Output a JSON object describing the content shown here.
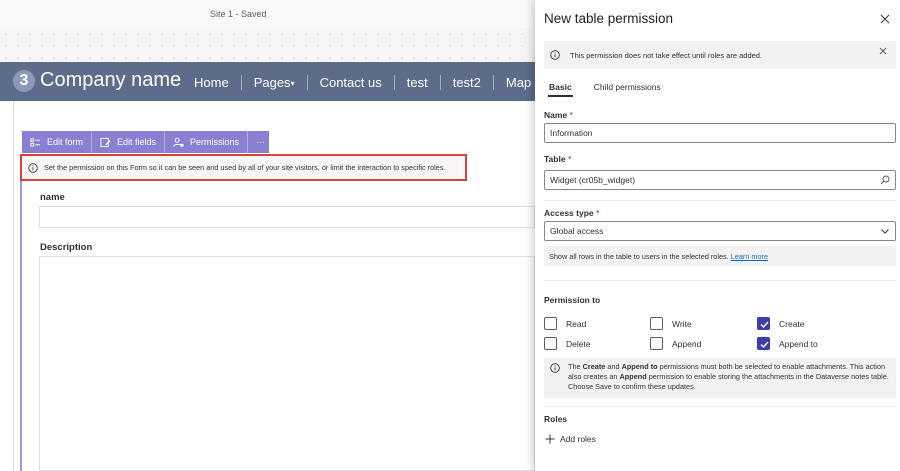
{
  "topbar": {
    "site_status": "Site 1 - Saved"
  },
  "site": {
    "logo_badge": "3",
    "company_name": "Company name",
    "nav": [
      "Home",
      "Pages",
      "Contact us",
      "test",
      "test2",
      "Map"
    ]
  },
  "form_toolbar": {
    "edit_form": "Edit form",
    "edit_fields": "Edit fields",
    "permissions": "Permissions",
    "more": "···"
  },
  "permission_notice": "Set the permission on this Form so it can be seen and used by all of your site visitors, or limit the interaction to specific roles.",
  "form_fields": {
    "name_label": "name",
    "description_label": "Description"
  },
  "panel": {
    "title": "New table permission",
    "message": "This permission does not take effect until roles are added.",
    "tabs": [
      "Basic",
      "Child permissions"
    ],
    "name": {
      "label": "Name",
      "required": "*",
      "value": "Information"
    },
    "table": {
      "label": "Table",
      "required": "*",
      "value": "Widget (cr05b_widget)"
    },
    "access_type": {
      "label": "Access type",
      "required": "*",
      "value": "Global access"
    },
    "access_note": "Show all rows in the table to users in the selected roles.",
    "learn_more": "Learn more",
    "permission_to": {
      "label": "Permission to",
      "read": {
        "label": "Read",
        "checked": false
      },
      "write": {
        "label": "Write",
        "checked": false
      },
      "create": {
        "label": "Create",
        "checked": true
      },
      "delete": {
        "label": "Delete",
        "checked": false
      },
      "append": {
        "label": "Append",
        "checked": false
      },
      "append_to": {
        "label": "Append to",
        "checked": true
      }
    },
    "attach_note": {
      "p1": "The ",
      "b1": "Create",
      "p2": " and ",
      "b2": "Append to",
      "p3": " permissions must both be selected to enable attachments. This action also creates an ",
      "b3": "Append",
      "p4": " permission to enable storing the attachments in the Dataverse notes table. Choose Save to confirm these updates."
    },
    "roles": {
      "label": "Roles",
      "add_roles": "Add roles"
    }
  },
  "colors": {
    "header_bg": "#5c6c8a",
    "toolbar_bg": "#8a7fd0",
    "checkbox_checked": "#3b3ea8",
    "notice_border": "#d9413a",
    "link": "#0f6cbd"
  }
}
